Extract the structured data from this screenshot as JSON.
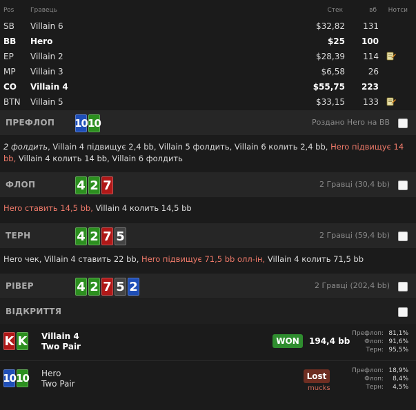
{
  "header": {
    "pos": "Pos",
    "player": "Гравець",
    "stack": "Стек",
    "bb": "вб",
    "notes": "Нотси"
  },
  "players": [
    {
      "pos": "SB",
      "name": "Villain 6",
      "stack": "$32,82",
      "bb": "131",
      "bold": false,
      "note": false
    },
    {
      "pos": "BB",
      "name": "Hero",
      "stack": "$25",
      "bb": "100",
      "bold": true,
      "note": false
    },
    {
      "pos": "EP",
      "name": "Villain 2",
      "stack": "$28,39",
      "bb": "114",
      "bold": false,
      "note": true
    },
    {
      "pos": "MP",
      "name": "Villain 3",
      "stack": "$6,58",
      "bb": "26",
      "bold": false,
      "note": false
    },
    {
      "pos": "CO",
      "name": "Villain 4",
      "stack": "$55,75",
      "bb": "223",
      "bold": true,
      "note": false
    },
    {
      "pos": "BTN",
      "name": "Villain 5",
      "stack": "$33,15",
      "bb": "133",
      "bold": false,
      "note": true
    }
  ],
  "preflop": {
    "label": "ПРЕФЛОП",
    "info": "Роздано Hero на BB",
    "cards": [
      {
        "rank": "10",
        "suit": "d"
      },
      {
        "rank": "10",
        "suit": "c"
      }
    ],
    "action_parts": [
      {
        "t": "2 фолдить",
        "cls": "ital"
      },
      {
        "t": ", Villain 4 підвищує 2,4 bb, Villain 5 фолдить, Villain 6 колить 2,4 bb, ",
        "cls": ""
      },
      {
        "t": "Hero підвищує 14 bb,",
        "cls": "hero"
      },
      {
        "t": " Villain 4 колить 14 bb, Villain 6 фолдить",
        "cls": ""
      }
    ]
  },
  "flop": {
    "label": "ФЛОП",
    "info": "2 Гравці (30,4 bb)",
    "cards": [
      {
        "rank": "4",
        "suit": "c"
      },
      {
        "rank": "2",
        "suit": "c"
      },
      {
        "rank": "7",
        "suit": "h"
      }
    ],
    "action_parts": [
      {
        "t": "Hero ставить 14,5 bb,",
        "cls": "hero"
      },
      {
        "t": " Villain 4 колить 14,5 bb",
        "cls": ""
      }
    ]
  },
  "turn": {
    "label": "ТЕРН",
    "info": "2 Гравці (59,4 bb)",
    "cards": [
      {
        "rank": "4",
        "suit": "c"
      },
      {
        "rank": "2",
        "suit": "c"
      },
      {
        "rank": "7",
        "suit": "h"
      },
      {
        "rank": "5",
        "suit": "s"
      }
    ],
    "action_parts": [
      {
        "t": "Hero чек, Villain 4 ставить 22 bb, ",
        "cls": ""
      },
      {
        "t": "Hero підвищує 71,5 bb олл-ін,",
        "cls": "hero"
      },
      {
        "t": " Villain 4 колить 71,5 bb",
        "cls": ""
      }
    ]
  },
  "river": {
    "label": "РІВЕР",
    "info": "2 Гравці (202,4 bb)",
    "cards": [
      {
        "rank": "4",
        "suit": "c"
      },
      {
        "rank": "2",
        "suit": "c"
      },
      {
        "rank": "7",
        "suit": "h"
      },
      {
        "rank": "5",
        "suit": "s"
      },
      {
        "rank": "2",
        "suit": "d"
      }
    ]
  },
  "showdown": {
    "label": "ВІДКРИТТЯ",
    "players": [
      {
        "name": "Villain 4",
        "hand": "Two Pair",
        "cards": [
          {
            "rank": "K",
            "suit": "h"
          },
          {
            "rank": "K",
            "suit": "c"
          }
        ],
        "result": "WON",
        "amount": "194,4 bb",
        "equity": [
          {
            "label": "Префлоп:",
            "value": "81,1%"
          },
          {
            "label": "Флоп:",
            "value": "91,6%"
          },
          {
            "label": "Терн:",
            "value": "95,5%"
          }
        ]
      },
      {
        "name": "Hero",
        "hand": "Two Pair",
        "cards": [
          {
            "rank": "10",
            "suit": "d"
          },
          {
            "rank": "10",
            "suit": "c"
          }
        ],
        "result": "Lost",
        "sub": "mucks",
        "equity": [
          {
            "label": "Префлоп:",
            "value": "18,9%"
          },
          {
            "label": "Флоп:",
            "value": "8,4%"
          },
          {
            "label": "Терн:",
            "value": "4,5%"
          }
        ]
      }
    ]
  }
}
